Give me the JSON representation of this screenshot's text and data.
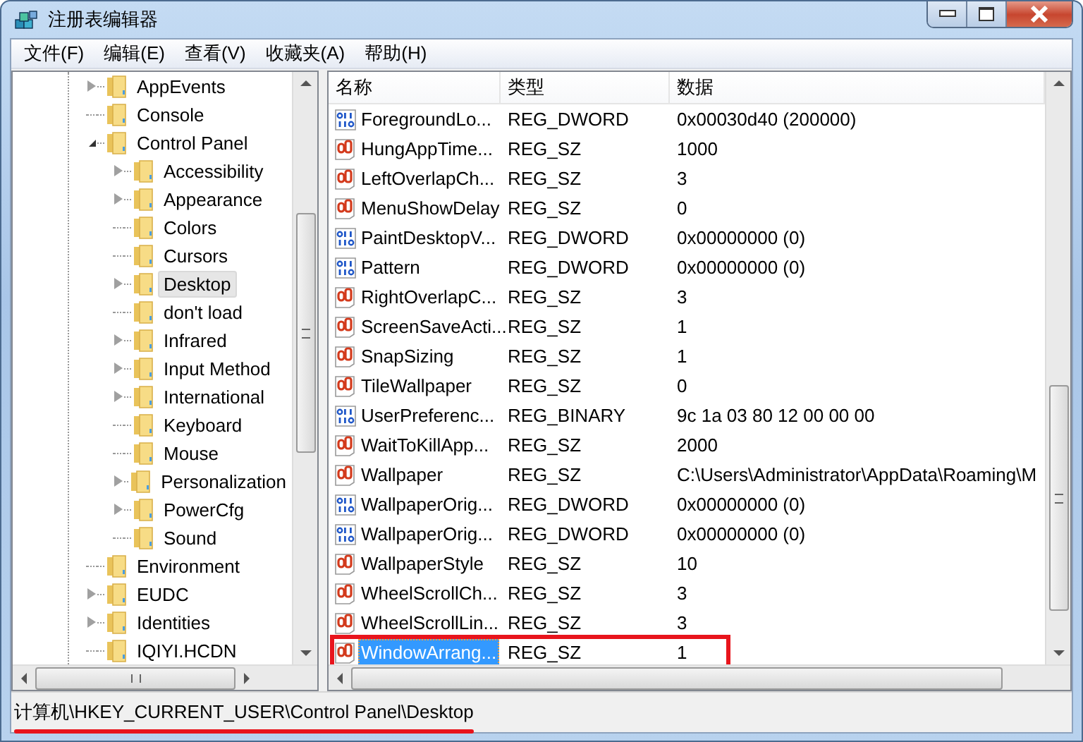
{
  "window": {
    "title": "注册表编辑器"
  },
  "menu": [
    "文件(F)",
    "编辑(E)",
    "查看(V)",
    "收藏夹(A)",
    "帮助(H)"
  ],
  "tree": [
    {
      "label": "AppEvents",
      "has_children": true,
      "expanded": false,
      "selected": false
    },
    {
      "label": "Console",
      "has_children": false,
      "selected": false
    },
    {
      "label": "Control Panel",
      "has_children": true,
      "expanded": true,
      "selected": false,
      "children": [
        {
          "label": "Accessibility",
          "has_children": true,
          "expanded": false,
          "selected": false
        },
        {
          "label": "Appearance",
          "has_children": true,
          "expanded": false,
          "selected": false
        },
        {
          "label": "Colors",
          "has_children": false,
          "selected": false
        },
        {
          "label": "Cursors",
          "has_children": false,
          "selected": false
        },
        {
          "label": "Desktop",
          "has_children": true,
          "expanded": false,
          "selected": true
        },
        {
          "label": "don't load",
          "has_children": false,
          "selected": false
        },
        {
          "label": "Infrared",
          "has_children": true,
          "expanded": false,
          "selected": false
        },
        {
          "label": "Input Method",
          "has_children": true,
          "expanded": false,
          "selected": false
        },
        {
          "label": "International",
          "has_children": true,
          "expanded": false,
          "selected": false
        },
        {
          "label": "Keyboard",
          "has_children": false,
          "selected": false
        },
        {
          "label": "Mouse",
          "has_children": false,
          "selected": false
        },
        {
          "label": "Personalization",
          "has_children": true,
          "expanded": false,
          "selected": false
        },
        {
          "label": "PowerCfg",
          "has_children": true,
          "expanded": false,
          "selected": false
        },
        {
          "label": "Sound",
          "has_children": false,
          "selected": false
        }
      ]
    },
    {
      "label": "Environment",
      "has_children": false,
      "selected": false
    },
    {
      "label": "EUDC",
      "has_children": true,
      "expanded": false,
      "selected": false
    },
    {
      "label": "Identities",
      "has_children": true,
      "expanded": false,
      "selected": false
    },
    {
      "label": "IQIYI.HCDN",
      "has_children": false,
      "selected": false
    }
  ],
  "values": {
    "columns": [
      "名称",
      "类型",
      "数据"
    ],
    "rows": [
      {
        "name": "ForegroundLo...",
        "type": "REG_DWORD",
        "data": "0x00030d40 (200000)",
        "kind": "dword",
        "selected": false,
        "annotated": false
      },
      {
        "name": "HungAppTime...",
        "type": "REG_SZ",
        "data": "1000",
        "kind": "string",
        "selected": false,
        "annotated": false
      },
      {
        "name": "LeftOverlapCh...",
        "type": "REG_SZ",
        "data": "3",
        "kind": "string",
        "selected": false,
        "annotated": false
      },
      {
        "name": "MenuShowDelay",
        "type": "REG_SZ",
        "data": "0",
        "kind": "string",
        "selected": false,
        "annotated": false
      },
      {
        "name": "PaintDesktopV...",
        "type": "REG_DWORD",
        "data": "0x00000000 (0)",
        "kind": "dword",
        "selected": false,
        "annotated": false
      },
      {
        "name": "Pattern",
        "type": "REG_DWORD",
        "data": "0x00000000 (0)",
        "kind": "dword",
        "selected": false,
        "annotated": false
      },
      {
        "name": "RightOverlapC...",
        "type": "REG_SZ",
        "data": "3",
        "kind": "string",
        "selected": false,
        "annotated": false
      },
      {
        "name": "ScreenSaveActi...",
        "type": "REG_SZ",
        "data": "1",
        "kind": "string",
        "selected": false,
        "annotated": false
      },
      {
        "name": "SnapSizing",
        "type": "REG_SZ",
        "data": "1",
        "kind": "string",
        "selected": false,
        "annotated": false
      },
      {
        "name": "TileWallpaper",
        "type": "REG_SZ",
        "data": "0",
        "kind": "string",
        "selected": false,
        "annotated": false
      },
      {
        "name": "UserPreferenc...",
        "type": "REG_BINARY",
        "data": "9c 1a 03 80 12 00 00 00",
        "kind": "binary",
        "selected": false,
        "annotated": false
      },
      {
        "name": "WaitToKillApp...",
        "type": "REG_SZ",
        "data": "2000",
        "kind": "string",
        "selected": false,
        "annotated": false
      },
      {
        "name": "Wallpaper",
        "type": "REG_SZ",
        "data": "C:\\Users\\Administrator\\AppData\\Roaming\\M",
        "kind": "string",
        "selected": false,
        "annotated": false
      },
      {
        "name": "WallpaperOrig...",
        "type": "REG_DWORD",
        "data": "0x00000000 (0)",
        "kind": "dword",
        "selected": false,
        "annotated": false
      },
      {
        "name": "WallpaperOrig...",
        "type": "REG_DWORD",
        "data": "0x00000000 (0)",
        "kind": "dword",
        "selected": false,
        "annotated": false
      },
      {
        "name": "WallpaperStyle",
        "type": "REG_SZ",
        "data": "10",
        "kind": "string",
        "selected": false,
        "annotated": false
      },
      {
        "name": "WheelScrollCh...",
        "type": "REG_SZ",
        "data": "3",
        "kind": "string",
        "selected": false,
        "annotated": false
      },
      {
        "name": "WheelScrollLin...",
        "type": "REG_SZ",
        "data": "3",
        "kind": "string",
        "selected": false,
        "annotated": false
      },
      {
        "name": "WindowArrang...",
        "type": "REG_SZ",
        "data": "1",
        "kind": "string",
        "selected": true,
        "annotated": true
      }
    ]
  },
  "status_bar": {
    "path": "计算机\\HKEY_CURRENT_USER\\Control Panel\\Desktop",
    "annotated": true
  }
}
